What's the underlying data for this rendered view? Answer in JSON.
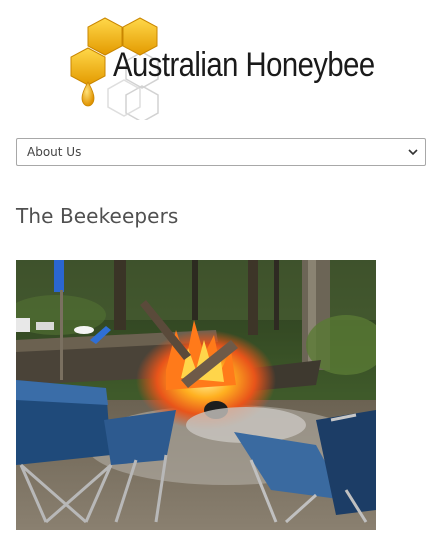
{
  "header": {
    "logo_text": "Australian Honeybee"
  },
  "nav": {
    "selected_label": "About Us"
  },
  "main": {
    "page_title": "The Beekeepers"
  },
  "colors": {
    "honey_gold": "#f2b115",
    "honey_dark": "#d98e00",
    "outline_gray": "#cccccc",
    "text_dark": "#1a1a1a",
    "title_gray": "#505050"
  },
  "icons": {
    "select_arrow": "chevron-down-icon",
    "logo_mark": "honeycomb-icon"
  }
}
